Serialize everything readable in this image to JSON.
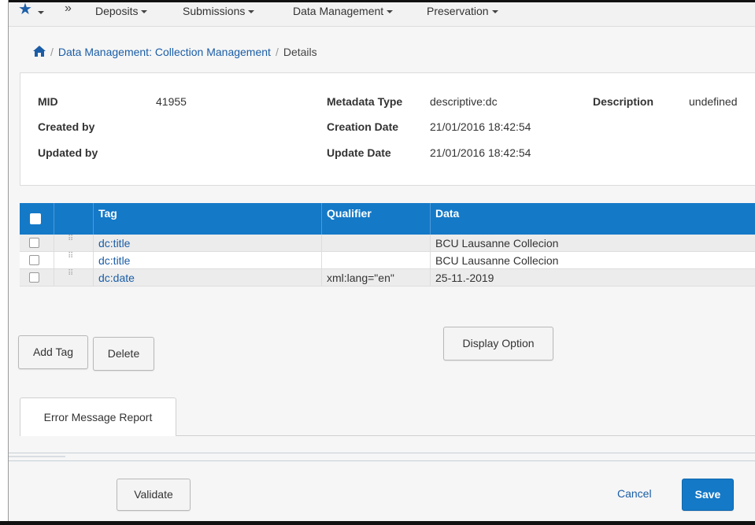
{
  "nav": {
    "items": [
      "Deposits",
      "Submissions",
      "Data Management",
      "Preservation"
    ],
    "more_glyph": "»",
    "star_glyph": "★"
  },
  "breadcrumb": {
    "link": "Data Management: Collection Management",
    "separator": "/",
    "current": "Details"
  },
  "details": {
    "mid_label": "MID",
    "mid_value": "41955",
    "created_by_label": "Created by",
    "updated_by_label": "Updated by",
    "metadata_type_label": "Metadata Type",
    "metadata_type_value": "descriptive:dc",
    "creation_date_label": "Creation Date",
    "creation_date_value": "21/01/2016 18:42:54",
    "update_date_label": "Update Date",
    "update_date_value": "21/01/2016 18:42:54",
    "description_label": "Description",
    "description_value": "undefined"
  },
  "table": {
    "headers": {
      "tag": "Tag",
      "qualifier": "Qualifier",
      "data": "Data"
    },
    "rows": [
      {
        "tag": "dc:title",
        "qualifier": "",
        "data": "BCU Lausanne Collecion"
      },
      {
        "tag": "dc:title",
        "qualifier": "",
        "data": "BCU Lausanne Collecion"
      },
      {
        "tag": "dc:date",
        "qualifier": "xml:lang=\"en\"",
        "data": "25-11.-2019"
      }
    ]
  },
  "actions": {
    "add_tag": "Add Tag",
    "delete": "Delete",
    "display_option": "Display Option",
    "validate": "Validate",
    "cancel": "Cancel",
    "save": "Save"
  },
  "tabs": {
    "error_report": "Error Message Report"
  },
  "colors": {
    "accent": "#1479c7",
    "link": "#1a5da6"
  }
}
